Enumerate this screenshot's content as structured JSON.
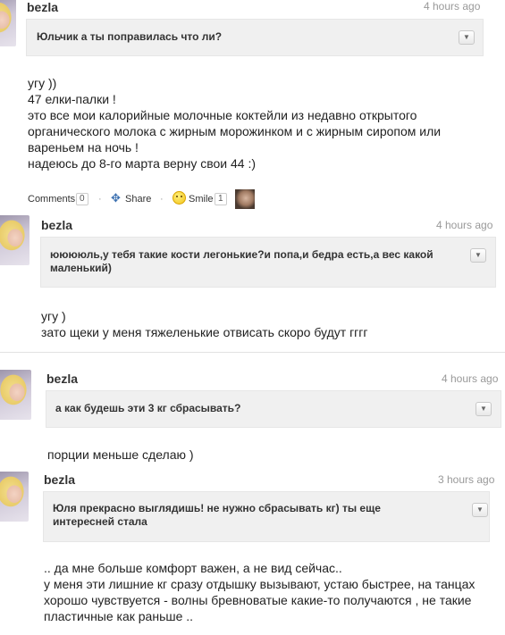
{
  "entries": [
    {
      "user": "bezla",
      "time": "4 hours ago",
      "question": "Юльчик а ты поправилась что ли?",
      "answer": [
        "угу ))",
        "47 елки-палки !",
        "это все мои калорийные молочные коктейли из недавно открытого",
        "органического молока с жирным морожинком и с жирным сиропом или",
        "вареньем на ночь !",
        "надеюсь до 8-го марта верну свои 44 :)"
      ]
    },
    {
      "user": "bezla",
      "time": "4 hours ago",
      "question": [
        "ююююль,у тебя такие кости легонькие?и попа,и бедра есть,а вес какой",
        "маленький)"
      ],
      "answer": [
        "угу )",
        "зато щеки у меня тяжеленькие отвисать скоро будут гггг"
      ]
    },
    {
      "user": "bezla",
      "time": "4 hours ago",
      "question": "а как будешь эти 3 кг сбрасывать?",
      "answer": [
        "порции меньше сделаю )"
      ]
    },
    {
      "user": "bezla",
      "time": "3 hours ago",
      "question": [
        "Юля прекрасно выглядишь! не нужно сбрасывать кг) ты еще",
        "интересней стала"
      ],
      "answer": [
        ".. да мне больше комфорт важен, а не вид сейчас..",
        "у меня эти лишние кг сразу отдышку вызывают, устаю быстрее, на танцах",
        "хорошо чувствуется - волны бревноватые какие-то получаются , не такие",
        "пластичные как раньше .."
      ]
    }
  ],
  "actions": {
    "comments_label": "Comments",
    "comments_count": "0",
    "share_label": "Share",
    "smile_label": "Smile",
    "smile_count": "1",
    "separator": "·"
  },
  "icons": {
    "dropdown": "chevron-down-icon",
    "share": "share-icon",
    "smile": "smile-icon",
    "avatar": "avatar"
  }
}
